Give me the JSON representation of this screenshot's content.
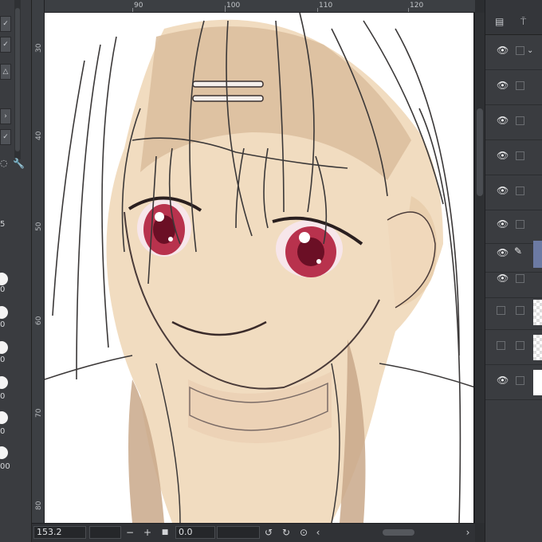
{
  "app": {
    "accent_color": "#6c7aa3"
  },
  "ruler_top": {
    "labels": [
      "90",
      "100",
      "110",
      "120"
    ]
  },
  "ruler_left": {
    "labels": [
      "30",
      "40",
      "50",
      "60",
      "70",
      "80"
    ]
  },
  "left_toolbar": {
    "brush_sizes": [
      "5",
      "0",
      "0",
      "0",
      "0",
      "00"
    ]
  },
  "status": {
    "zoom_value": "153.2",
    "rotate_value": "0.0",
    "zoom_out_label": "−",
    "zoom_in_label": "+"
  },
  "layers": {
    "rows": [
      {
        "visible": true,
        "selected": false,
        "thumb": "none"
      },
      {
        "visible": true,
        "selected": false,
        "thumb": "none"
      },
      {
        "visible": true,
        "selected": false,
        "thumb": "none"
      },
      {
        "visible": true,
        "selected": false,
        "thumb": "none"
      },
      {
        "visible": true,
        "selected": false,
        "thumb": "none"
      },
      {
        "visible": true,
        "selected": false,
        "thumb": "none"
      },
      {
        "visible": true,
        "selected": true,
        "thumb": "none"
      },
      {
        "visible": true,
        "selected": false,
        "thumb": "none"
      },
      {
        "visible": false,
        "selected": false,
        "thumb": "checker"
      },
      {
        "visible": false,
        "selected": false,
        "thumb": "checker"
      },
      {
        "visible": true,
        "selected": false,
        "thumb": "white"
      }
    ]
  },
  "icons": {
    "eye": "eye-icon",
    "pen": "pen-icon",
    "wrench": "wrench-icon",
    "chevron": "chevron-down-icon"
  }
}
